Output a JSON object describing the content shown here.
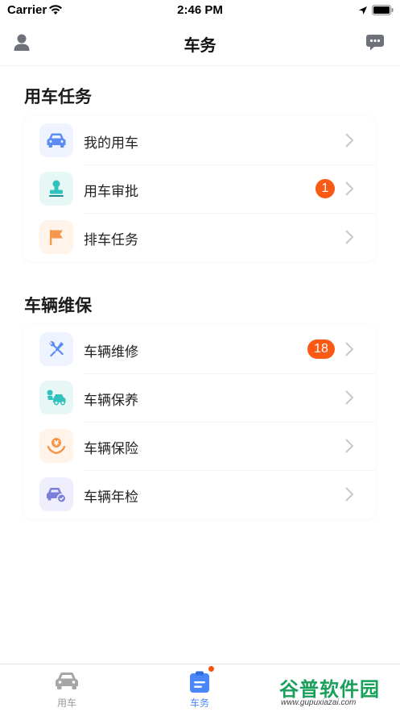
{
  "status_bar": {
    "carrier": "Carrier",
    "time": "2:46 PM"
  },
  "header": {
    "title": "车务"
  },
  "sections": [
    {
      "title": "用车任务",
      "items": [
        {
          "label": "我的用车",
          "icon": "car-icon",
          "badge": ""
        },
        {
          "label": "用车审批",
          "icon": "stamp-icon",
          "badge": "1"
        },
        {
          "label": "排车任务",
          "icon": "flag-icon",
          "badge": ""
        }
      ]
    },
    {
      "title": "车辆维保",
      "items": [
        {
          "label": "车辆维修",
          "icon": "wrench-screwdriver-icon",
          "badge": "18"
        },
        {
          "label": "车辆保养",
          "icon": "car-wash-icon",
          "badge": ""
        },
        {
          "label": "车辆保险",
          "icon": "insurance-icon",
          "badge": ""
        },
        {
          "label": "车辆年检",
          "icon": "car-inspection-icon",
          "badge": ""
        }
      ]
    }
  ],
  "tabs": [
    {
      "label": "用车",
      "icon": "car-icon",
      "active": false
    },
    {
      "label": "车务",
      "icon": "clipboard-icon",
      "active": true
    }
  ],
  "watermark": {
    "text": "谷普软件园",
    "url": "www.gupuxiazai.com"
  },
  "colors": {
    "accent": "#4a86f7",
    "badge": "#fa5a14",
    "inactive_tab": "#9a9a9a",
    "watermark": "#19a05a"
  }
}
